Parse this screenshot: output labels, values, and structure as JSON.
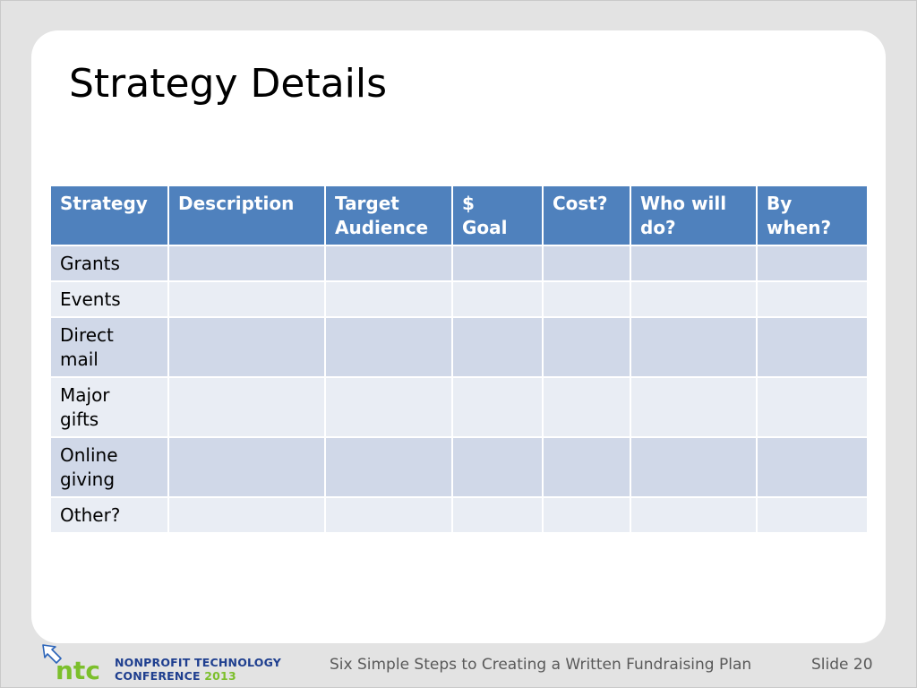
{
  "slide": {
    "title": "Strategy Details",
    "footer_title": "Six Simple Steps to Creating a Written Fundraising Plan",
    "footer_slide": "Slide 20"
  },
  "logo": {
    "icon": "ntc-arrow-logo",
    "text": "ntc",
    "line1": "NONPROFIT TECHNOLOGY",
    "line2": "CONFERENCE",
    "year": "2013"
  },
  "colors": {
    "header": "#4f81bd",
    "row_odd": "#d0d8e8",
    "row_even": "#e9edf4",
    "logo_green": "#7cbf2c",
    "logo_blue": "#1f3f8f"
  },
  "table": {
    "headers": [
      [
        "Strategy"
      ],
      [
        "Description"
      ],
      [
        "Target",
        "Audience"
      ],
      [
        "$",
        "Goal"
      ],
      [
        "Cost?"
      ],
      [
        "Who will",
        "do?"
      ],
      [
        "By",
        "when?"
      ]
    ],
    "rows": [
      [
        "Grants"
      ],
      [
        "Events"
      ],
      [
        "Direct",
        "mail"
      ],
      [
        "Major",
        "gifts"
      ],
      [
        "Online",
        "giving"
      ],
      [
        "Other?"
      ]
    ]
  }
}
